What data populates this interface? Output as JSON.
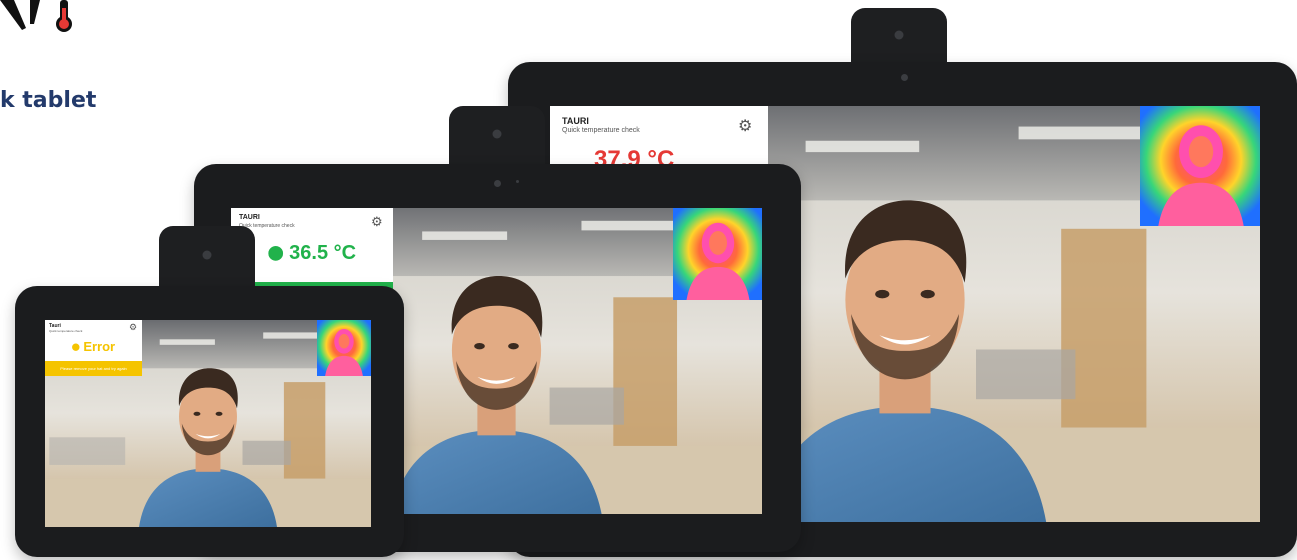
{
  "page": {
    "heading": "k tablet",
    "logo_icon": "thermometer-logo-icon",
    "accent": "#233a6b"
  },
  "tablets": {
    "large": {
      "brand": "TAURI",
      "subtitle": "Quick temperature check",
      "temperature": "37.9 °C",
      "status_color": "#e53935",
      "settings_icon": "gear-icon"
    },
    "medium": {
      "brand": "TAURI",
      "subtitle": "Quick temperature check",
      "temperature": "36.5 °C",
      "status_color": "#21b24b",
      "settings_icon": "gear-icon"
    },
    "small": {
      "brand": "Tauri",
      "subtitle": "Quick temperature check",
      "temperature": "Error",
      "status_bar_text": "Please remove your hat and try again",
      "status_color": "#f5c400",
      "settings_icon": "gear-icon"
    }
  }
}
